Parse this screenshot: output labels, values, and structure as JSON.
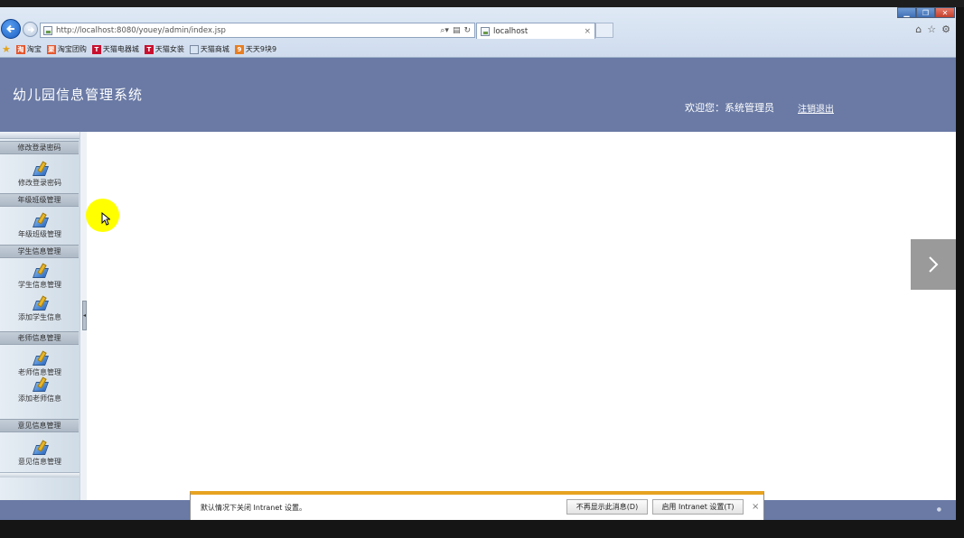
{
  "browser": {
    "address": "http://localhost:8080/youey/admin/index.jsp",
    "tab_title": "localhost",
    "favorites": [
      "淘宝",
      "淘宝团购",
      "天猫电器城",
      "天猫女装",
      "天猫商城",
      "天天9块9"
    ]
  },
  "header": {
    "title": "幼儿园信息管理系统",
    "welcome": "欢迎您：系统管理员",
    "logout": "注销退出"
  },
  "sidebar": {
    "groups": [
      {
        "title": "修改登录密码",
        "items": [
          "修改登录密码"
        ]
      },
      {
        "title": "年级班级管理",
        "items": [
          "年级班级管理"
        ]
      },
      {
        "title": "学生信息管理",
        "items": [
          "学生信息管理",
          "添加学生信息"
        ]
      },
      {
        "title": "老师信息管理",
        "items": [
          "老师信息管理",
          "添加老师信息"
        ]
      },
      {
        "title": "意见信息管理",
        "items": [
          "意见信息管理"
        ]
      }
    ]
  },
  "notification": {
    "message": "默认情况下关闭 Intranet 设置。",
    "dismiss_label": "不再显示此消息(D)",
    "enable_label": "启用 Intranet 设置(T)",
    "close_label": "×"
  },
  "icons": {
    "back": "back-arrow-icon",
    "forward": "forward-arrow-icon",
    "next": "chevron-right-icon",
    "close": "close-icon"
  },
  "colors": {
    "header_bg": "#6a7aa5",
    "notification_accent": "#e7a321",
    "next_button_bg": "#9a9a9a"
  }
}
